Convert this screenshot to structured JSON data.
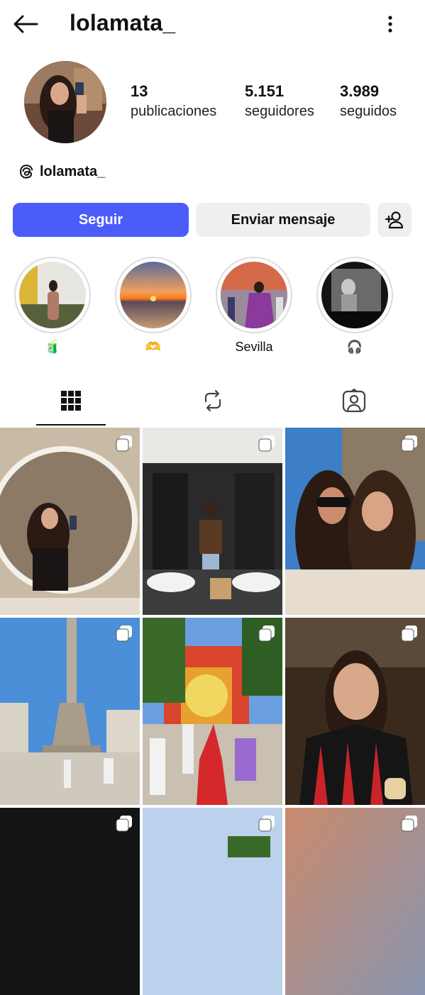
{
  "header": {
    "username": "lolamata_",
    "back_icon": "arrow-left-icon",
    "menu_icon": "more-vertical-icon"
  },
  "profile": {
    "stats": [
      {
        "value": "13",
        "label": "publicaciones"
      },
      {
        "value": "5.151",
        "label": "seguidores"
      },
      {
        "value": "3.989",
        "label": "seguidos"
      }
    ],
    "threads_handle": "lolamata_"
  },
  "actions": {
    "follow_label": "Seguir",
    "message_label": "Enviar mensaje",
    "add_person_icon": "person-add-icon"
  },
  "highlights": [
    {
      "caption": "🧃"
    },
    {
      "caption": "🫶"
    },
    {
      "caption": "Sevilla"
    },
    {
      "caption": "🎧"
    }
  ],
  "tabs": [
    {
      "name": "grid",
      "icon": "grid-icon",
      "active": true
    },
    {
      "name": "reposts",
      "icon": "repost-icon",
      "active": false
    },
    {
      "name": "tagged",
      "icon": "tagged-person-icon",
      "active": false
    }
  ],
  "colors": {
    "accent": "#4a5df9",
    "button_bg": "#efeff2"
  }
}
